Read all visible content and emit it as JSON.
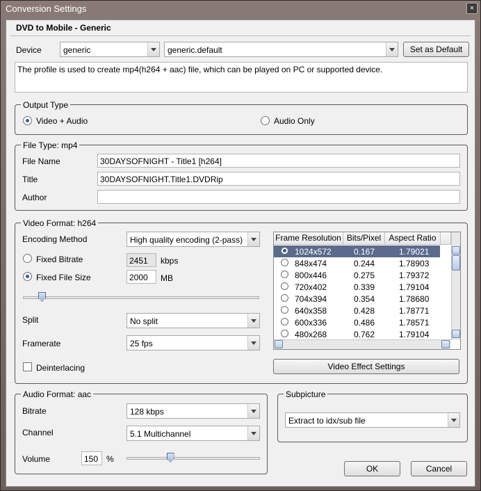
{
  "window": {
    "title": "Conversion Settings",
    "close": "×"
  },
  "profile": {
    "title": "DVD to Mobile - Generic",
    "device_label": "Device",
    "device_value": "generic",
    "profile_value": "generic.default",
    "set_default": "Set as Default",
    "description": "The profile is used to create mp4(h264 + aac) file, which can be played on PC or supported device."
  },
  "output_type": {
    "title": "Output Type",
    "options": [
      {
        "label": "Video + Audio",
        "selected": true
      },
      {
        "label": "Audio Only",
        "selected": false
      }
    ]
  },
  "file_type": {
    "title": "File Type: mp4",
    "file_name_label": "File Name",
    "file_name_value": "30DAYSOFNIGHT - Title1 [h264]",
    "title_label": "Title",
    "title_value": "30DAYSOFNIGHT.Title1.DVDRip",
    "author_label": "Author",
    "author_value": ""
  },
  "video_format": {
    "title": "Video Format: h264",
    "encoding_label": "Encoding Method",
    "encoding_value": "High quality encoding (2-pass)",
    "fixed_bitrate_label": "Fixed Bitrate",
    "fixed_bitrate_value": "2451",
    "kbps_unit": "kbps",
    "fixed_size_label": "Fixed File Size",
    "fixed_size_value": "2000",
    "mb_unit": "MB",
    "size_mode": "fixed_file_size",
    "quality_slider_fraction": 0.05,
    "split_label": "Split",
    "split_value": "No split",
    "framerate_label": "Framerate",
    "framerate_value": "25 fps",
    "deinterlacing_label": "Deinterlacing",
    "deinterlacing_checked": false,
    "effect_button": "Video Effect Settings"
  },
  "resolution_table": {
    "headers": [
      "Frame Resolution",
      "Bits/Pixel",
      "Aspect Ratio"
    ],
    "rows": [
      {
        "resolution": "1024x572",
        "bpp": "0.167",
        "aspect": "1.79021",
        "selected": true
      },
      {
        "resolution": "848x474",
        "bpp": "0.244",
        "aspect": "1.78903",
        "selected": false
      },
      {
        "resolution": "800x446",
        "bpp": "0.275",
        "aspect": "1.79372",
        "selected": false
      },
      {
        "resolution": "720x402",
        "bpp": "0.339",
        "aspect": "1.79104",
        "selected": false
      },
      {
        "resolution": "704x394",
        "bpp": "0.354",
        "aspect": "1.78680",
        "selected": false
      },
      {
        "resolution": "640x358",
        "bpp": "0.428",
        "aspect": "1.78771",
        "selected": false
      },
      {
        "resolution": "600x336",
        "bpp": "0.486",
        "aspect": "1.78571",
        "selected": false
      },
      {
        "resolution": "480x268",
        "bpp": "0.762",
        "aspect": "1.79104",
        "selected": false
      }
    ]
  },
  "audio_format": {
    "title": "Audio Format: aac",
    "bitrate_label": "Bitrate",
    "bitrate_value": "128 kbps",
    "channel_label": "Channel",
    "channel_value": "5.1 Multichannel",
    "volume_label": "Volume",
    "volume_value": "150",
    "volume_unit": "%",
    "volume_slider_fraction": 0.3
  },
  "subpicture": {
    "title": "Subpicture",
    "value": "Extract to idx/sub file"
  },
  "buttons": {
    "ok": "OK",
    "cancel": "Cancel"
  },
  "colors": {
    "selection": "#5a6b8c",
    "radio_dot": "#2a5fa8"
  }
}
